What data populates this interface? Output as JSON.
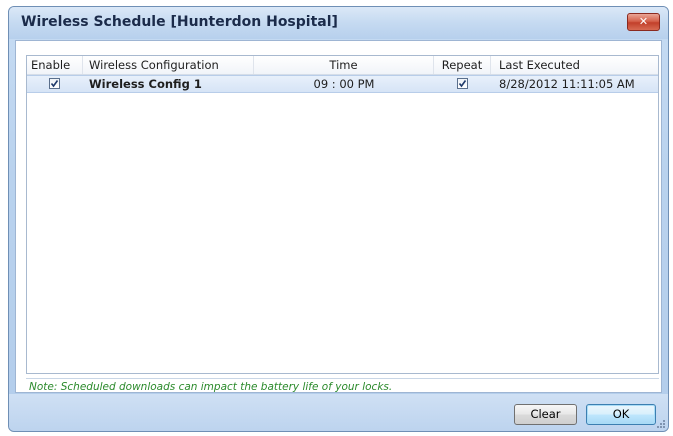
{
  "window": {
    "title": "Wireless Schedule [Hunterdon Hospital]",
    "close_label": "✕"
  },
  "grid": {
    "columns": [
      "Enable",
      "Wireless Configuration",
      "Time",
      "Repeat",
      "Last Executed"
    ],
    "rows": [
      {
        "enable": true,
        "configuration": "Wireless Config 1",
        "time": "09 : 00 PM",
        "repeat": true,
        "last_executed": "8/28/2012 11:11:05 AM"
      }
    ]
  },
  "note": "Note: Scheduled downloads can impact the battery life of your locks.",
  "buttons": {
    "clear": "Clear",
    "ok": "OK"
  },
  "colors": {
    "note_text": "#2b8a2b",
    "close_button": "#c2402b",
    "selected_row": "#d6e4f6"
  }
}
